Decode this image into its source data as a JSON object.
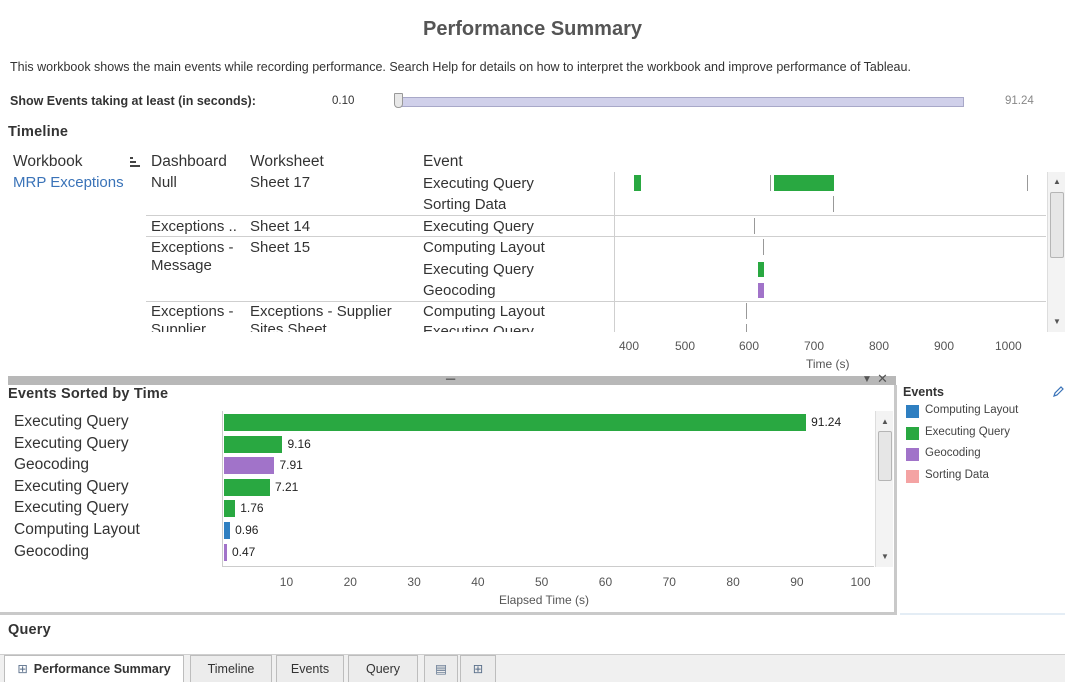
{
  "header": {
    "title": "Performance Summary",
    "description": "This workbook shows the main events while recording performance. Search Help for details on how to interpret the workbook and improve performance of Tableau.",
    "threshold_label": "Show Events taking at least (in seconds):",
    "threshold_min": "0.10",
    "threshold_max": "91.24",
    "threshold_value": 0.1
  },
  "timeline": {
    "title": "Timeline",
    "columns": {
      "workbook": "Workbook",
      "dashboard": "Dashboard",
      "worksheet": "Worksheet",
      "event": "Event"
    },
    "rows": {
      "workbook": "MRP Exceptions",
      "r1_dashboard": "Null",
      "r1_worksheet": "Sheet 17",
      "r1_event_1": "Executing Query",
      "r1_event_2": "Sorting Data",
      "r2_dashboard": "Exceptions ..",
      "r2_worksheet": "Sheet 14",
      "r2_event_1": "Executing Query",
      "r3_dashboard_1": "Exceptions -",
      "r3_dashboard_2": "Message",
      "r3_worksheet": "Sheet 15",
      "r3_event_1": "Computing Layout",
      "r3_event_2": "Executing Query",
      "r3_event_3": "Geocoding",
      "r4_dashboard_1": "Exceptions -",
      "r4_dashboard_2": "Supplier",
      "r4_worksheet_1": "Exceptions - Supplier",
      "r4_worksheet_2": "Sites Sheet",
      "r4_event_1": "Computing Layout",
      "r4_event_2": "Executing Query"
    },
    "axis_ticks": [
      "400",
      "500",
      "600",
      "700",
      "800",
      "900",
      "1000"
    ],
    "axis_label": "Time (s)"
  },
  "events_sorted": {
    "title": "Events Sorted by Time",
    "axis_ticks": [
      "10",
      "20",
      "30",
      "40",
      "50",
      "60",
      "70",
      "80",
      "90",
      "100"
    ],
    "axis_label": "Elapsed Time (s)"
  },
  "legend": {
    "title": "Events",
    "items": [
      {
        "label": "Computing Layout",
        "color": "#2f7fc1"
      },
      {
        "label": "Executing Query",
        "color": "#29a841"
      },
      {
        "label": "Geocoding",
        "color": "#a173c9"
      },
      {
        "label": "Sorting Data",
        "color": "#f4a3a3"
      }
    ]
  },
  "query": {
    "title": "Query"
  },
  "tabs": {
    "performance_summary": "Performance Summary",
    "timeline": "Timeline",
    "events": "Events",
    "query": "Query"
  },
  "chart_data": {
    "type": "bar",
    "orientation": "horizontal",
    "categories": [
      "Executing Query",
      "Executing Query",
      "Geocoding",
      "Executing Query",
      "Executing Query",
      "Computing Layout",
      "Geocoding"
    ],
    "values": [
      91.24,
      9.16,
      7.91,
      7.21,
      1.76,
      0.96,
      0.47
    ],
    "value_labels": [
      "91.24",
      "9.16",
      "7.91",
      "7.21",
      "1.76",
      "0.96",
      "0.47"
    ],
    "colors": [
      "#29a841",
      "#29a841",
      "#a173c9",
      "#29a841",
      "#29a841",
      "#2f7fc1",
      "#a173c9"
    ],
    "xlabel": "Elapsed Time (s)",
    "xlim": [
      0,
      100
    ],
    "title": "Events Sorted by Time"
  }
}
